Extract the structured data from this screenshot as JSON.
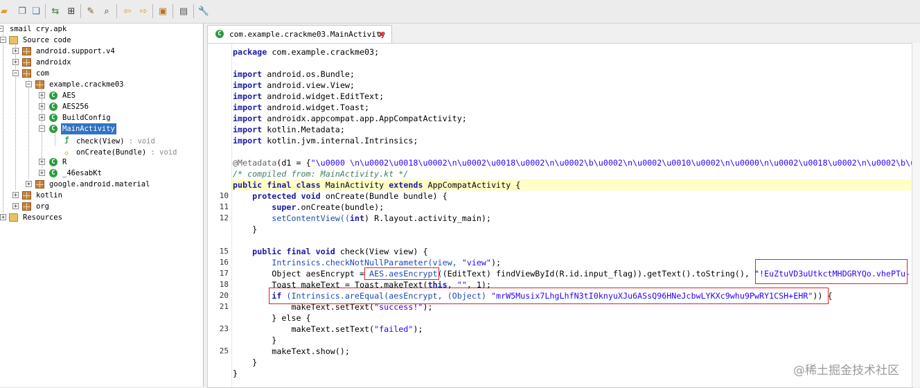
{
  "toolbar": {
    "icons": [
      "open-icon",
      "copy-icon",
      "duplicate-icon",
      "sync-icon",
      "grid-icon",
      "wand-icon",
      "search-icon",
      "back-icon",
      "forward-icon",
      "decompile-icon",
      "log-icon",
      "settings-icon"
    ]
  },
  "tree": {
    "root": "smail cry.apk",
    "source_code": "Source code",
    "packages": {
      "android_support": "android.support.v4",
      "androidx": "androidx",
      "com": "com",
      "example": "example.crackme03",
      "google": "google.android.material",
      "kotlin": "kotlin",
      "org": "org"
    },
    "classes": [
      "AES",
      "AES256",
      "BuildConfig",
      "MainActivity",
      "R",
      "_46esabKt"
    ],
    "methods": [
      {
        "name": "check(View)",
        "sig": " : void"
      },
      {
        "name": "onCreate(Bundle)",
        "sig": " : void"
      }
    ],
    "resources": "Resources"
  },
  "tab": {
    "title": "com.example.crackme03.MainActivity",
    "close": "✖"
  },
  "line_numbers": [
    "10",
    "11",
    "12",
    "15",
    "16",
    "17",
    "18",
    "20",
    "21",
    "23",
    "25"
  ],
  "code": {
    "package": "com.example.crackme03;",
    "imports": [
      "android.os.Bundle;",
      "android.view.View;",
      "android.widget.EditText;",
      "android.widget.Toast;",
      "androidx.appcompat.app.AppCompatActivity;",
      "kotlin.Metadata;",
      "kotlin.jvm.internal.Intrinsics;"
    ],
    "metadata_head": "@Metadata",
    "metadata_args": "(d1 = {",
    "metadata_str": "\"\\u0000 \\n\\u0002\\u0018\\u0002\\n\\u0002\\u0018\\u0002\\n\\u0002\\b\\u0002\\n\\u0002\\u0010\\u0002\\n\\u0000\\n\\u0002\\u0018\\u0002\\n\\u0002\\b\\u",
    "compiled_comment": "/* compiled from: MainActivity.kt */",
    "class_decl_kw": "public final class",
    "class_name": "MainActivity",
    "extends_kw": "extends",
    "super_class": "AppCompatActivity {",
    "on_create_sig": "onCreate(Bundle bundle) {",
    "super_call": ".onCreate(bundle);",
    "set_content": "setContentView((",
    "set_content_int": "int",
    "set_content_rest": ") R.layout.activity_main);",
    "close_brace": "}",
    "check_sig": "check(View view) {",
    "null_check": "Intrinsics.checkNotNullParameter(view, ",
    "null_check_str": "\"view\"",
    "null_check_end": ");",
    "aes_line_pre": "Object aesEncrypt = ",
    "aes_call": "AES.aesEncrypt(",
    "aes_line_mid": "(EditText) findViewById(R.id.input_flag)).getText().toString(), ",
    "aes_key": "\"!EuZtuVD3uUtkctMHDGRYQo.vhePTu-",
    "toast_line_pre": "Toast makeText = Toast.makeText(",
    "toast_this": "this",
    "toast_str": "\"\"",
    "toast_end": ", 1);",
    "if_kw": "if",
    "if_mid": " (Intrinsics.areEqual(aesEncrypt, (Object) ",
    "cipher": "\"mrW5Musix7LhgLhfN3tI0knyuXJu6ASsQ96HNeJcbwLYKXc9whu9PwRY1CSH+EHR\"",
    "if_end": ")) {",
    "set_success": "makeText.setText(",
    "success_str": "\"success!\"",
    "set_failed_str": "\"failed\"",
    "else_kw": "} else {",
    "show": "makeText.show();",
    "kw_package": "package",
    "kw_import": "import",
    "kw_protected": "protected void",
    "kw_super": "super",
    "kw_public": "public final void"
  },
  "watermark": "@稀土掘金技术社区"
}
